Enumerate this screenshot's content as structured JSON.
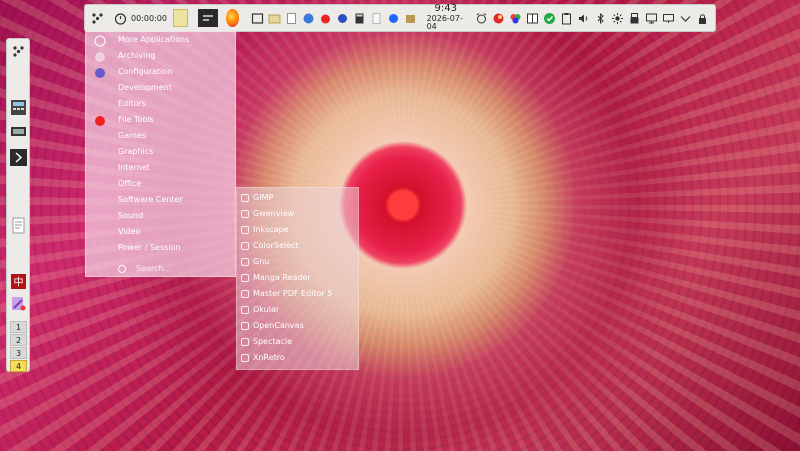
{
  "topbar": {
    "timer": "00:00:00",
    "clock_time": "9:43",
    "clock_date": "2026-07-04"
  },
  "menu": {
    "items": [
      "More Applications",
      "Archiving",
      "Configuration",
      "Development",
      "Editors",
      "File Tools",
      "Games",
      "Graphics",
      "Internet",
      "Office",
      "Software Center",
      "Sound",
      "Video",
      "Power / Session"
    ],
    "search_placeholder": "Search..."
  },
  "submenu": {
    "items": [
      "GIMP",
      "Gwenview",
      "Inkscape",
      "ColorSelect",
      "Gnu",
      "Manga Reader",
      "Master PDF Editor 5",
      "Okular",
      "OpenCanvas",
      "Spectacle",
      "XnRetro"
    ]
  },
  "desktops": [
    "1",
    "2",
    "3",
    "4"
  ],
  "colors": {
    "panel_bg": "#ecebe8",
    "active_desktop": "#f4dc5a",
    "menu_bg": "#f5d4e6"
  },
  "icons": {
    "top": [
      "launcher-icon",
      "stopwatch-icon",
      "notes-icon",
      "terminal-icon",
      "firefox-icon",
      "taskbar-app-icons",
      "alarm-icon",
      "network-icon",
      "bookmark-icon",
      "check-icon",
      "clipboard-icon",
      "volume-icon",
      "bluetooth-icon",
      "brightness-icon",
      "display-icon",
      "monitor-icon",
      "chevron-down-icon",
      "lock-icon"
    ],
    "left": [
      "launcher-icon",
      "calculator-icon",
      "keyboard-icon",
      "arrow-right-icon",
      "document-icon",
      "mahjong-icon",
      "paint-icon"
    ]
  }
}
